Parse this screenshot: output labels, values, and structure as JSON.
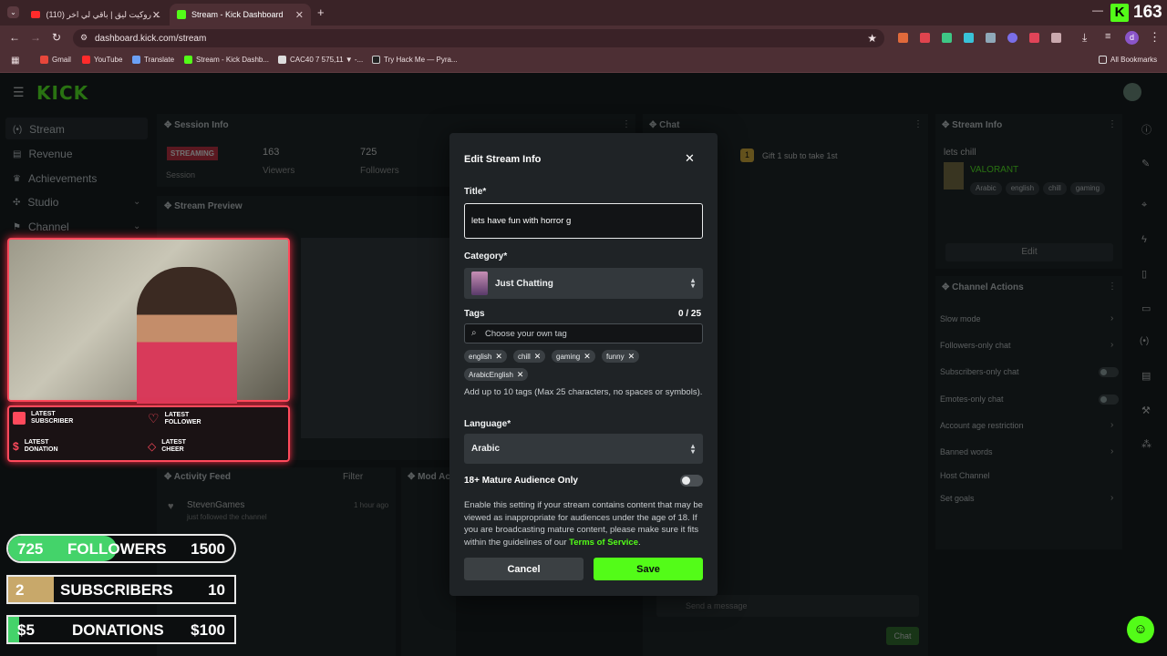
{
  "browser": {
    "tabs": [
      {
        "label": "(110) روكيت ليق | باقي لي اخر ..."
      },
      {
        "label": "Stream - Kick Dashboard"
      }
    ],
    "url": "dashboard.kick.com/stream",
    "bookmarks": [
      "Gmail",
      "YouTube",
      "Translate",
      "Stream - Kick Dashb...",
      "CAC40 7 575,11 ▼ -...",
      "Try Hack Me — Pyra..."
    ],
    "all_bookmarks": "All Bookmarks",
    "profile_initial": "d",
    "overlay_count": "163"
  },
  "brand": {
    "logo": "KICK",
    "accent": "#53fc18"
  },
  "sidebar": {
    "items": [
      {
        "label": "Stream"
      },
      {
        "label": "Revenue"
      },
      {
        "label": "Achievements"
      },
      {
        "label": "Studio"
      },
      {
        "label": "Channel"
      }
    ]
  },
  "session": {
    "title": "Session Info",
    "status": "STREAMING",
    "session_label": "Session",
    "viewers": "163",
    "viewers_label": "Viewers",
    "followers": "725",
    "followers_label": "Followers"
  },
  "preview": {
    "title": "Stream Preview"
  },
  "overlay": {
    "latest": [
      {
        "line1": "LATEST",
        "line2": "SUBSCRIBER"
      },
      {
        "line1": "LATEST",
        "line2": "FOLLOWER"
      },
      {
        "line1": "LATEST",
        "line2": "DONATION"
      },
      {
        "line1": "LATEST",
        "line2": "CHEER"
      }
    ],
    "goals": [
      {
        "current": "725",
        "label": "FOLLOWERS",
        "target": "1500",
        "fill": 0.48,
        "color": "#44d36a"
      },
      {
        "current": "2",
        "label": "SUBSCRIBERS",
        "target": "10",
        "fill": 0.2,
        "color": "#c8a86a"
      },
      {
        "current": "$5",
        "label": "DONATIONS",
        "target": "$100",
        "fill": 0.05,
        "color": "#44d36a"
      }
    ]
  },
  "activity": {
    "title": "Activity Feed",
    "filter": "Filter",
    "user": "StevenGames",
    "time": "1 hour ago",
    "action": "just followed the channel"
  },
  "mod": {
    "title": "Mod Ac"
  },
  "chat": {
    "title": "Chat",
    "gift": "Gift 1 sub to take 1st",
    "placeholder": "Send a message",
    "send": "Chat"
  },
  "stream_info": {
    "title": "Stream Info",
    "stream_title": "lets chill",
    "category": "VALORANT",
    "tags": [
      "Arabic",
      "english",
      "chill",
      "gaming"
    ],
    "edit": "Edit"
  },
  "channel_actions": {
    "title": "Channel Actions",
    "items": [
      {
        "label": "Slow mode"
      },
      {
        "label": "Followers-only chat"
      },
      {
        "label": "Subscribers-only chat"
      },
      {
        "label": "Emotes-only chat"
      },
      {
        "label": "Account age restriction"
      },
      {
        "label": "Banned words"
      },
      {
        "label": "Host Channel"
      },
      {
        "label": "Set goals"
      }
    ]
  },
  "modal": {
    "heading": "Edit Stream Info",
    "title_label": "Title*",
    "title_value": "lets have fun with horror g",
    "category_label": "Category*",
    "category_value": "Just Chatting",
    "tags_label": "Tags",
    "tags_count": "0 / 25",
    "tag_placeholder": "Choose your own tag",
    "tags": [
      "english",
      "chill",
      "gaming",
      "funny",
      "ArabicEnglish"
    ],
    "tags_help": "Add up to 10 tags (Max 25 characters, no spaces or symbols).",
    "language_label": "Language*",
    "language_value": "Arabic",
    "mature_label": "18+ Mature Audience Only",
    "mature_help": "Enable this setting if your stream contains content that may be viewed as inappropriate for audiences under the age of 18. If you are broadcasting mature content, please make sure it fits within the guidelines of our",
    "tos": "Terms of Service",
    "tos_end": ".",
    "cancel": "Cancel",
    "save": "Save"
  }
}
